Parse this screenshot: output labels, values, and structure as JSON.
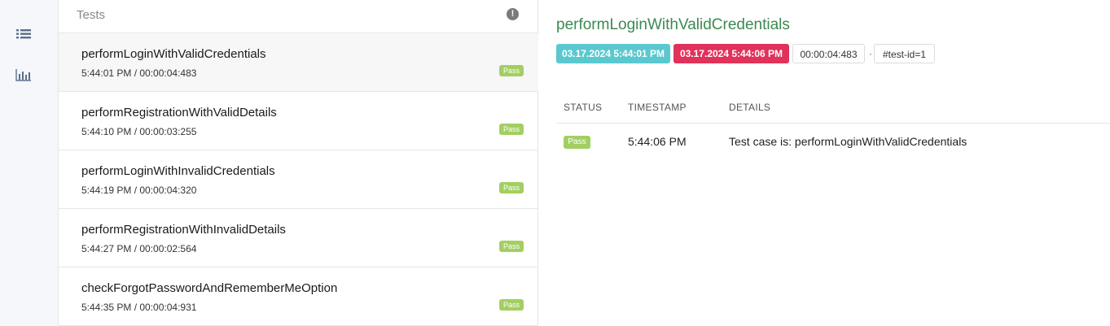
{
  "sidebar": {
    "items": [
      {
        "icon": "list-icon"
      },
      {
        "icon": "bar-chart-icon"
      }
    ]
  },
  "test_list": {
    "title": "Tests",
    "alert_icon": "!",
    "items": [
      {
        "name": "performLoginWithValidCredentials",
        "meta": "5:44:01 PM / 00:00:04:483",
        "status": "Pass"
      },
      {
        "name": "performRegistrationWithValidDetails",
        "meta": "5:44:10 PM / 00:00:03:255",
        "status": "Pass"
      },
      {
        "name": "performLoginWithInvalidCredentials",
        "meta": "5:44:19 PM / 00:00:04:320",
        "status": "Pass"
      },
      {
        "name": "performRegistrationWithInvalidDetails",
        "meta": "5:44:27 PM / 00:00:02:564",
        "status": "Pass"
      },
      {
        "name": "checkForgotPasswordAndRememberMeOption",
        "meta": "5:44:35 PM / 00:00:04:931",
        "status": "Pass"
      }
    ]
  },
  "detail": {
    "title": "performLoginWithValidCredentials",
    "start_time": "03.17.2024 5:44:01 PM",
    "end_time": "03.17.2024 5:44:06 PM",
    "duration": "00:00:04:483",
    "separator": "·",
    "test_id": "#test-id=1",
    "log": {
      "headers": {
        "status": "STATUS",
        "timestamp": "TIMESTAMP",
        "details": "DETAILS"
      },
      "rows": [
        {
          "status": "Pass",
          "timestamp": "5:44:06 PM",
          "details": "Test case is: performLoginWithValidCredentials"
        }
      ]
    }
  },
  "colors": {
    "pass": "#a3cf62",
    "start_chip": "#5bc8cf",
    "end_chip": "#e0325a",
    "title_green": "#3c8a4f"
  }
}
